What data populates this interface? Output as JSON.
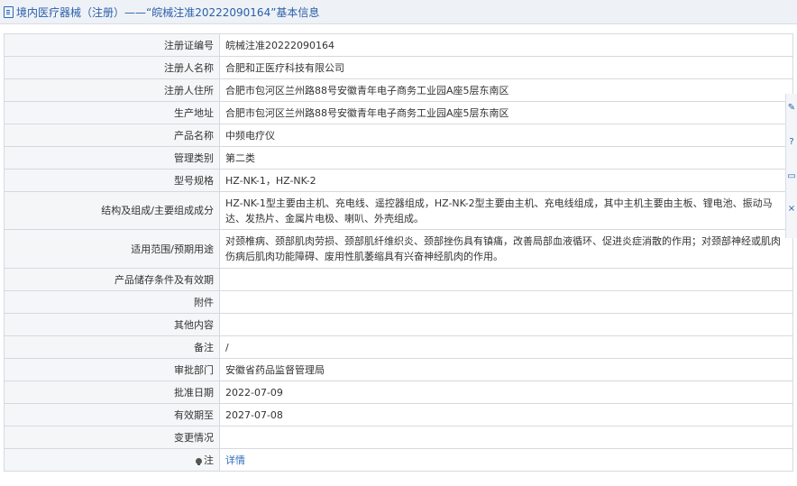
{
  "header": {
    "title": "境内医疗器械（注册）——“皖械注准20222090164”基本信息"
  },
  "rows": [
    {
      "label": "注册证编号",
      "value": "皖械注准20222090164"
    },
    {
      "label": "注册人名称",
      "value": "合肥和正医疗科技有限公司"
    },
    {
      "label": "注册人住所",
      "value": "合肥市包河区兰州路88号安徽青年电子商务工业园A座5层东南区"
    },
    {
      "label": "生产地址",
      "value": "合肥市包河区兰州路88号安徽青年电子商务工业园A座5层东南区"
    },
    {
      "label": "产品名称",
      "value": "中频电疗仪"
    },
    {
      "label": "管理类别",
      "value": "第二类"
    },
    {
      "label": "型号规格",
      "value": "HZ-NK-1，HZ-NK-2"
    },
    {
      "label": "结构及组成/主要组成成分",
      "value": "HZ-NK-1型主要由主机、充电线、遥控器组成，HZ-NK-2型主要由主机、充电线组成，其中主机主要由主板、锂电池、振动马达、发热片、金属片电极、喇叭、外壳组成。"
    },
    {
      "label": "适用范围/预期用途",
      "value": "对颈椎病、颈部肌肉劳损、颈部肌纤维织炎、颈部挫伤具有镇痛，改善局部血液循环、促进炎症消散的作用；对颈部神经或肌肉伤病后肌肉功能障碍、废用性肌萎缩具有兴奋神经肌肉的作用。"
    },
    {
      "label": "产品储存条件及有效期",
      "value": ""
    },
    {
      "label": "附件",
      "value": ""
    },
    {
      "label": "其他内容",
      "value": ""
    },
    {
      "label": "备注",
      "value": "/"
    },
    {
      "label": "审批部门",
      "value": "安徽省药品监督管理局"
    },
    {
      "label": "批准日期",
      "value": "2022-07-09"
    },
    {
      "label": "有效期至",
      "value": "2027-07-08"
    },
    {
      "label": "变更情况",
      "value": ""
    },
    {
      "label": "注",
      "value": "详情"
    }
  ],
  "sidebar_tools": [
    "edit-icon",
    "help-icon",
    "chat-icon",
    "close-icon"
  ]
}
